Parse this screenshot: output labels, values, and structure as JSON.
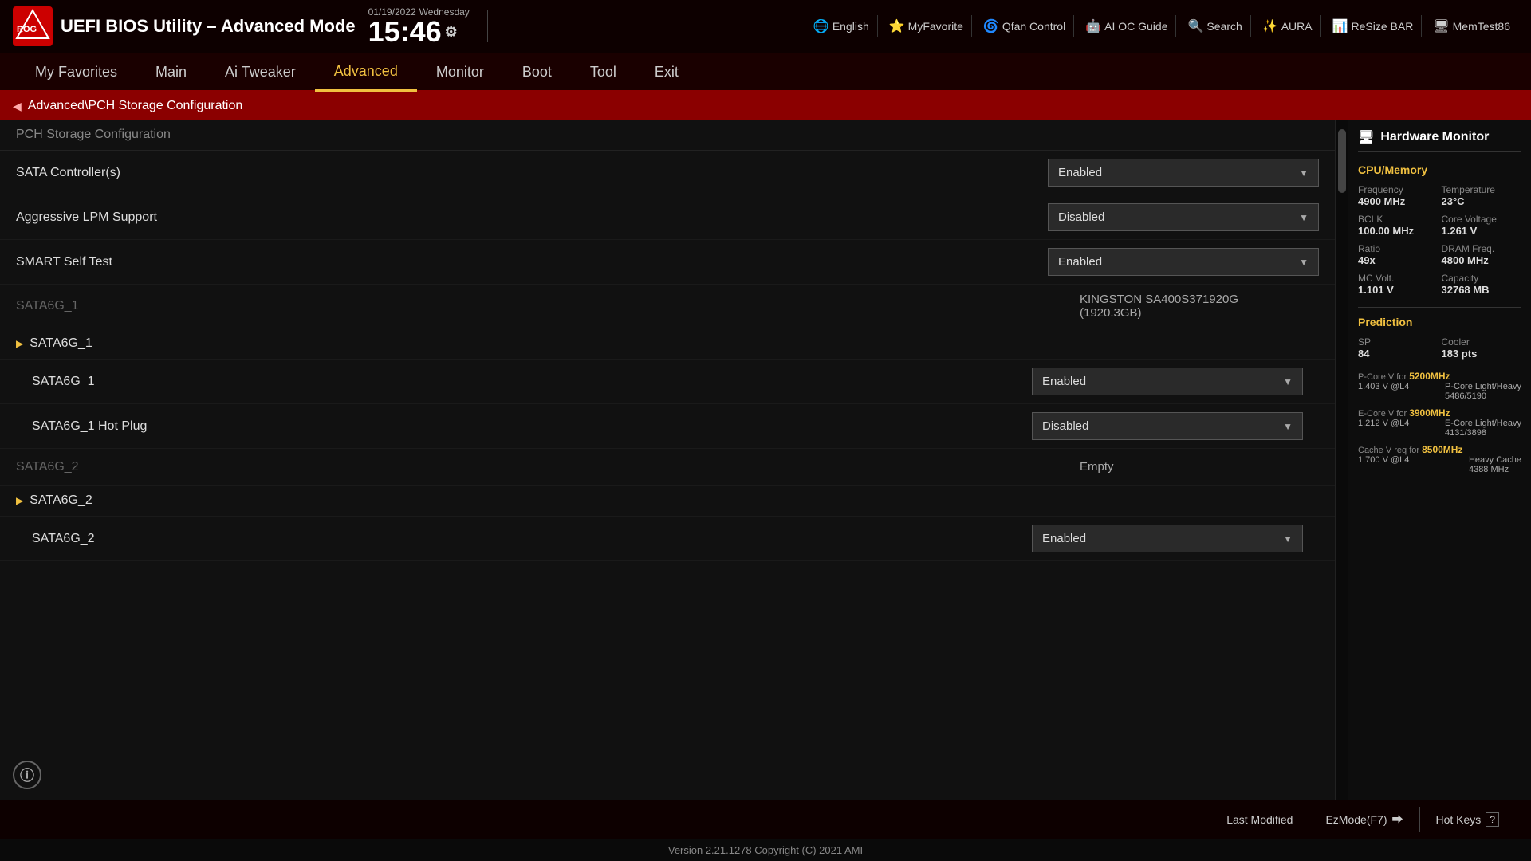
{
  "bios": {
    "title": "UEFI BIOS Utility – Advanced Mode",
    "datetime": {
      "date": "01/19/2022",
      "day": "Wednesday",
      "time": "15:46"
    }
  },
  "toolbar": {
    "items": [
      {
        "icon": "🌐",
        "label": "English"
      },
      {
        "icon": "⭐",
        "label": "MyFavorite"
      },
      {
        "icon": "🌀",
        "label": "Qfan Control"
      },
      {
        "icon": "🤖",
        "label": "AI OC Guide"
      },
      {
        "icon": "?",
        "label": "Search"
      },
      {
        "icon": "✨",
        "label": "AURA"
      },
      {
        "icon": "📊",
        "label": "ReSize BAR"
      },
      {
        "icon": "🖥",
        "label": "MemTest86"
      }
    ]
  },
  "nav": {
    "items": [
      {
        "label": "My Favorites",
        "active": false
      },
      {
        "label": "Main",
        "active": false
      },
      {
        "label": "Ai Tweaker",
        "active": false
      },
      {
        "label": "Advanced",
        "active": true
      },
      {
        "label": "Monitor",
        "active": false
      },
      {
        "label": "Boot",
        "active": false
      },
      {
        "label": "Tool",
        "active": false
      },
      {
        "label": "Exit",
        "active": false
      }
    ]
  },
  "breadcrumb": {
    "text": "Advanced\\PCH Storage Configuration"
  },
  "content": {
    "section_header": "PCH Storage Configuration",
    "settings": [
      {
        "id": "sata_controllers",
        "label": "SATA Controller(s)",
        "type": "dropdown",
        "value": "Enabled"
      },
      {
        "id": "aggressive_lpm",
        "label": "Aggressive LPM Support",
        "type": "dropdown",
        "value": "Disabled"
      },
      {
        "id": "smart_self_test",
        "label": "SMART Self Test",
        "type": "dropdown",
        "value": "Enabled"
      }
    ],
    "sata6g_1_info": {
      "label": "SATA6G_1",
      "value_line1": "KINGSTON SA400S371920G",
      "value_line2": "(1920.3GB)"
    },
    "group_sata6g_1": {
      "label": "SATA6G_1",
      "sub_settings": [
        {
          "id": "sata6g1_enable",
          "label": "SATA6G_1",
          "type": "dropdown",
          "value": "Enabled"
        },
        {
          "id": "sata6g1_hotplug",
          "label": "SATA6G_1 Hot Plug",
          "type": "dropdown",
          "value": "Disabled"
        }
      ]
    },
    "sata6g_2_info": {
      "label": "SATA6G_2",
      "value": "Empty"
    },
    "group_sata6g_2": {
      "label": "SATA6G_2",
      "sub_settings": [
        {
          "id": "sata6g2_enable",
          "label": "SATA6G_2",
          "type": "dropdown",
          "value": "Enabled"
        }
      ]
    }
  },
  "hw_monitor": {
    "title": "Hardware Monitor",
    "cpu_memory": {
      "title": "CPU/Memory",
      "frequency_label": "Frequency",
      "frequency_value": "4900 MHz",
      "temperature_label": "Temperature",
      "temperature_value": "23°C",
      "bclk_label": "BCLK",
      "bclk_value": "100.00 MHz",
      "core_voltage_label": "Core Voltage",
      "core_voltage_value": "1.261 V",
      "ratio_label": "Ratio",
      "ratio_value": "49x",
      "dram_freq_label": "DRAM Freq.",
      "dram_freq_value": "4800 MHz",
      "mc_volt_label": "MC Volt.",
      "mc_volt_value": "1.101 V",
      "capacity_label": "Capacity",
      "capacity_value": "32768 MB"
    },
    "prediction": {
      "title": "Prediction",
      "sp_label": "SP",
      "sp_value": "84",
      "cooler_label": "Cooler",
      "cooler_value": "183 pts",
      "pcore_label": "P-Core V for",
      "pcore_freq": "5200MHz",
      "pcore_detail_label": "P-Core\nLight/Heavy",
      "pcore_volt": "1.403 V @L4",
      "pcore_detail_value": "5486/5190",
      "ecore_label": "E-Core V for",
      "ecore_freq": "3900MHz",
      "ecore_detail_label": "E-Core\nLight/Heavy",
      "ecore_volt": "1.212 V @L4",
      "ecore_detail_value": "4131/3898",
      "cache_label": "Cache V req\nfor",
      "cache_freq": "8500MHz",
      "cache_detail_label": "Heavy Cache",
      "cache_volt": "1.700 V @L4",
      "cache_detail_value": "4388 MHz"
    }
  },
  "footer": {
    "last_modified": "Last Modified",
    "ez_mode": "EzMode(F7)",
    "hot_keys": "Hot Keys",
    "version": "Version 2.21.1278 Copyright (C) 2021 AMI"
  }
}
